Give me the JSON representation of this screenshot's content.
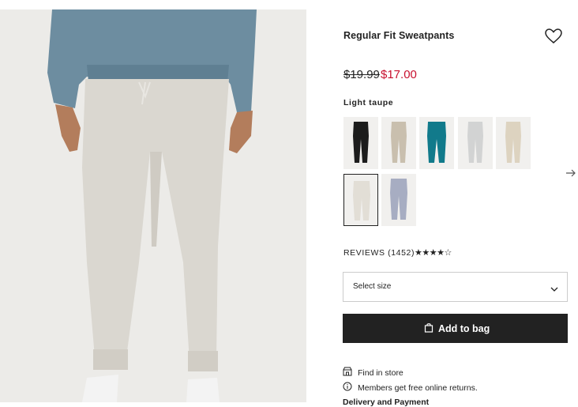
{
  "product": {
    "title": "Regular Fit Sweatpants",
    "price_old": "$19.99",
    "price_new": "$17.00",
    "color_label": "Light taupe"
  },
  "swatches": [
    {
      "name": "black",
      "color": "#1c1c1c"
    },
    {
      "name": "beige",
      "color": "#c9bfae"
    },
    {
      "name": "teal",
      "color": "#117a8b"
    },
    {
      "name": "light-grey",
      "color": "#d2d3d3"
    },
    {
      "name": "cream",
      "color": "#ddd3c0"
    },
    {
      "name": "light-taupe",
      "color": "#e2ded6",
      "selected": true
    },
    {
      "name": "blue-grey",
      "color": "#a7adc2"
    }
  ],
  "reviews": {
    "label": "REVIEWS (1452)",
    "stars": "★★★★☆",
    "rating": 4.5
  },
  "size_select": {
    "placeholder": "Select size"
  },
  "add_to_bag": {
    "label": "Add to bag"
  },
  "info": {
    "find_in_store": "Find in store",
    "members_returns": "Members get free online returns.",
    "delivery": "Delivery and Payment"
  },
  "colors": {
    "sale": "#c8102e",
    "button": "#222222",
    "photo_bg": "#ecebe8"
  }
}
